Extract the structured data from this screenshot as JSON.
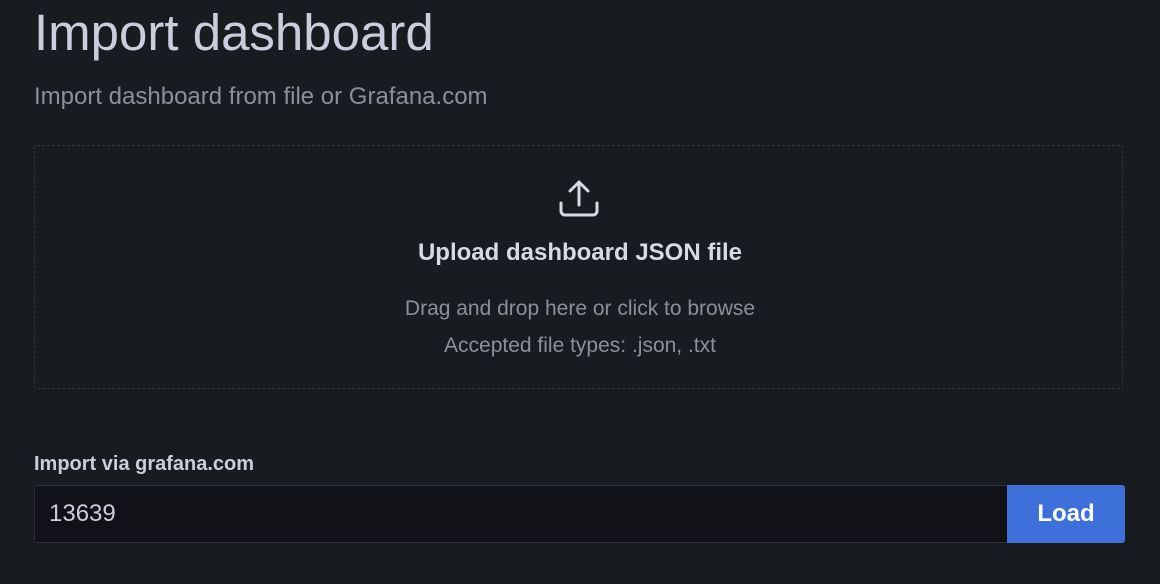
{
  "header": {
    "title": "Import dashboard",
    "subtitle": "Import dashboard from file or Grafana.com"
  },
  "upload": {
    "icon": "upload-icon",
    "title": "Upload dashboard JSON file",
    "hint": "Drag and drop here or click to browse",
    "accepted_types": "Accepted file types: .json, .txt"
  },
  "grafana_com": {
    "label": "Import via grafana.com",
    "input_value": "13639",
    "load_label": "Load"
  },
  "colors": {
    "background": "#181b1f",
    "primary_button": "#3d71d9",
    "text_primary": "#ccccdc",
    "text_secondary": "#8e8e9a"
  }
}
